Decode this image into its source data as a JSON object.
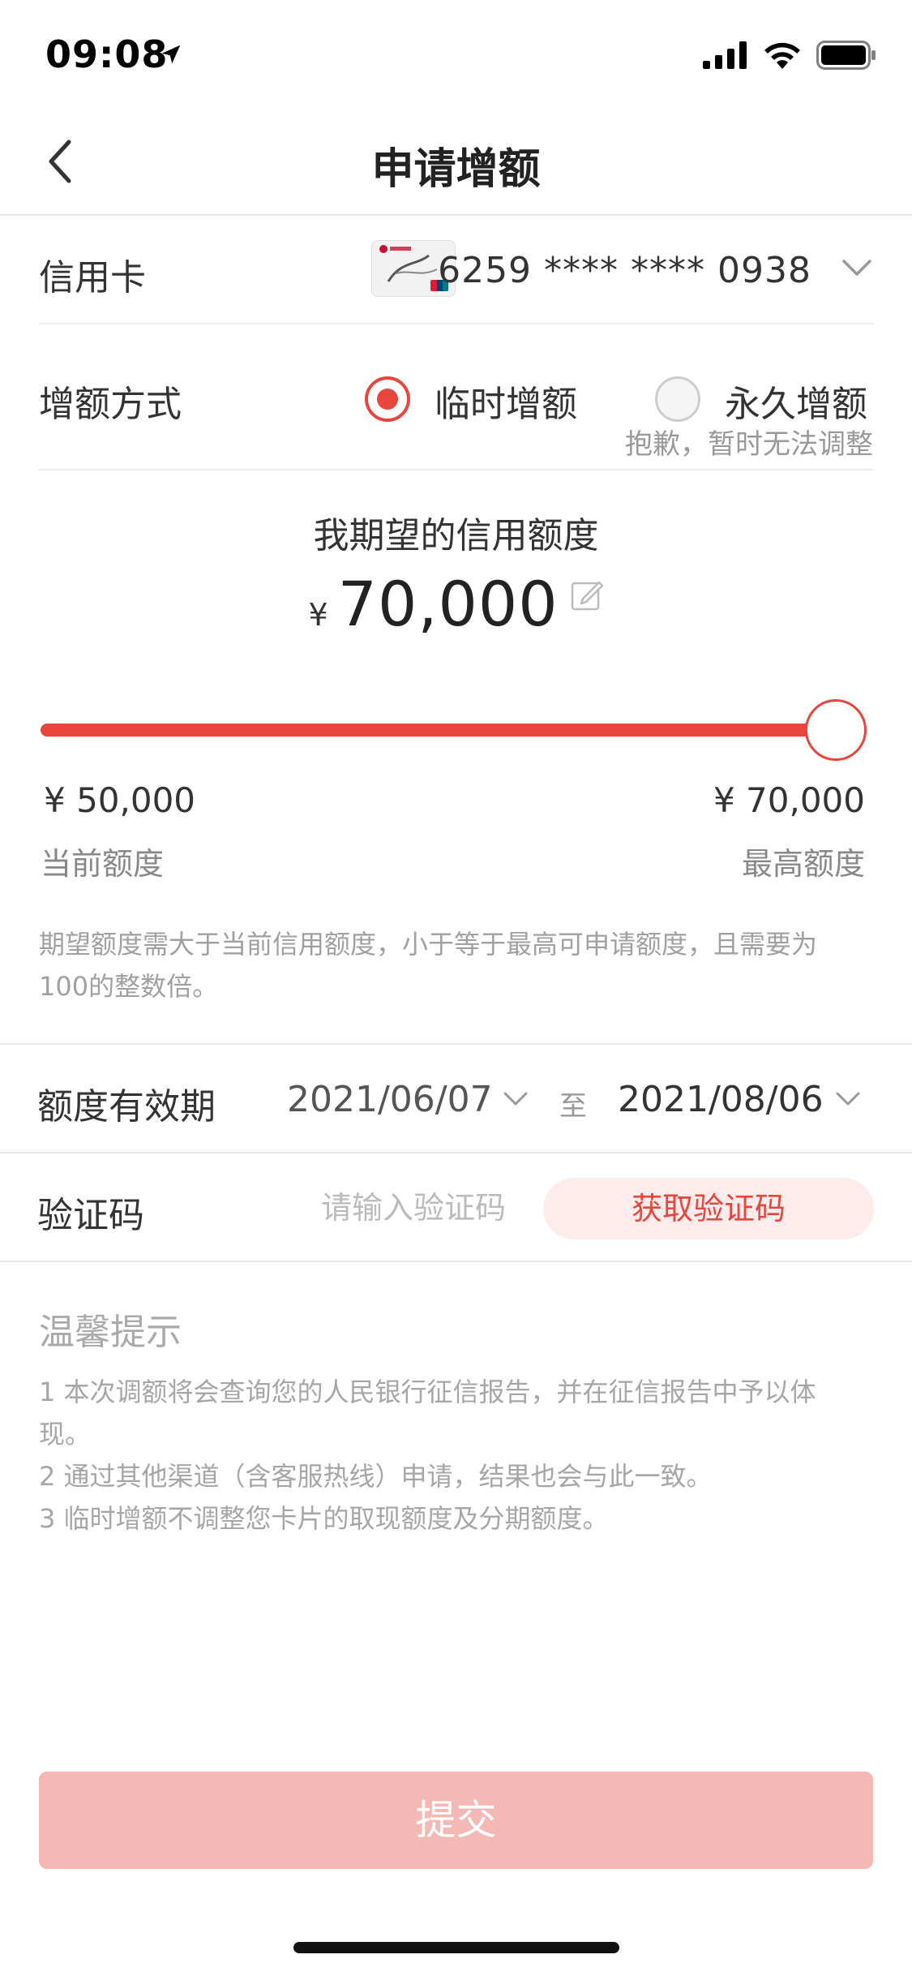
{
  "status_bar": {
    "time": "09:08"
  },
  "nav": {
    "title": "申请增额"
  },
  "card": {
    "label": "信用卡",
    "number": "6259 **** **** 0938"
  },
  "method": {
    "label": "增额方式",
    "option_temp": "临时增额",
    "option_perm": "永久增额",
    "selected": "临时增额",
    "perm_note": "抱歉，暂时无法调整"
  },
  "expect": {
    "title": "我期望的信用额度",
    "currency": "¥",
    "amount": "70,000"
  },
  "slider": {
    "min_value": "¥ 50,000",
    "max_value": "¥ 70,000",
    "min_label": "当前额度",
    "max_label": "最高额度",
    "level": 1.0
  },
  "hint": "期望额度需大于当前信用额度，小于等于最高可申请额度，且需要为100的整数倍。",
  "validity": {
    "label": "额度有效期",
    "start": "2021/06/07",
    "separator": "至",
    "end": "2021/08/06"
  },
  "verify": {
    "label": "验证码",
    "placeholder": "请输入验证码",
    "button": "获取验证码"
  },
  "tips": {
    "title": "温馨提示",
    "items": [
      "1  本次调额将会查询您的人民银行征信报告，并在征信报告中予以体现。",
      "2  通过其他渠道（含客服热线）申请，结果也会与此一致。",
      "3  临时增额不调整您卡片的取现额度及分期额度。"
    ]
  },
  "submit": {
    "label": "提交"
  },
  "colors": {
    "accent": "#e8453c",
    "accent_light": "#fdeceb",
    "submit_disabled": "#f4b9b4"
  },
  "icons": [
    "location-arrow-icon",
    "signal-icon",
    "wifi-icon",
    "battery-icon",
    "back-arrow-icon",
    "chevron-down-icon",
    "edit-icon"
  ]
}
